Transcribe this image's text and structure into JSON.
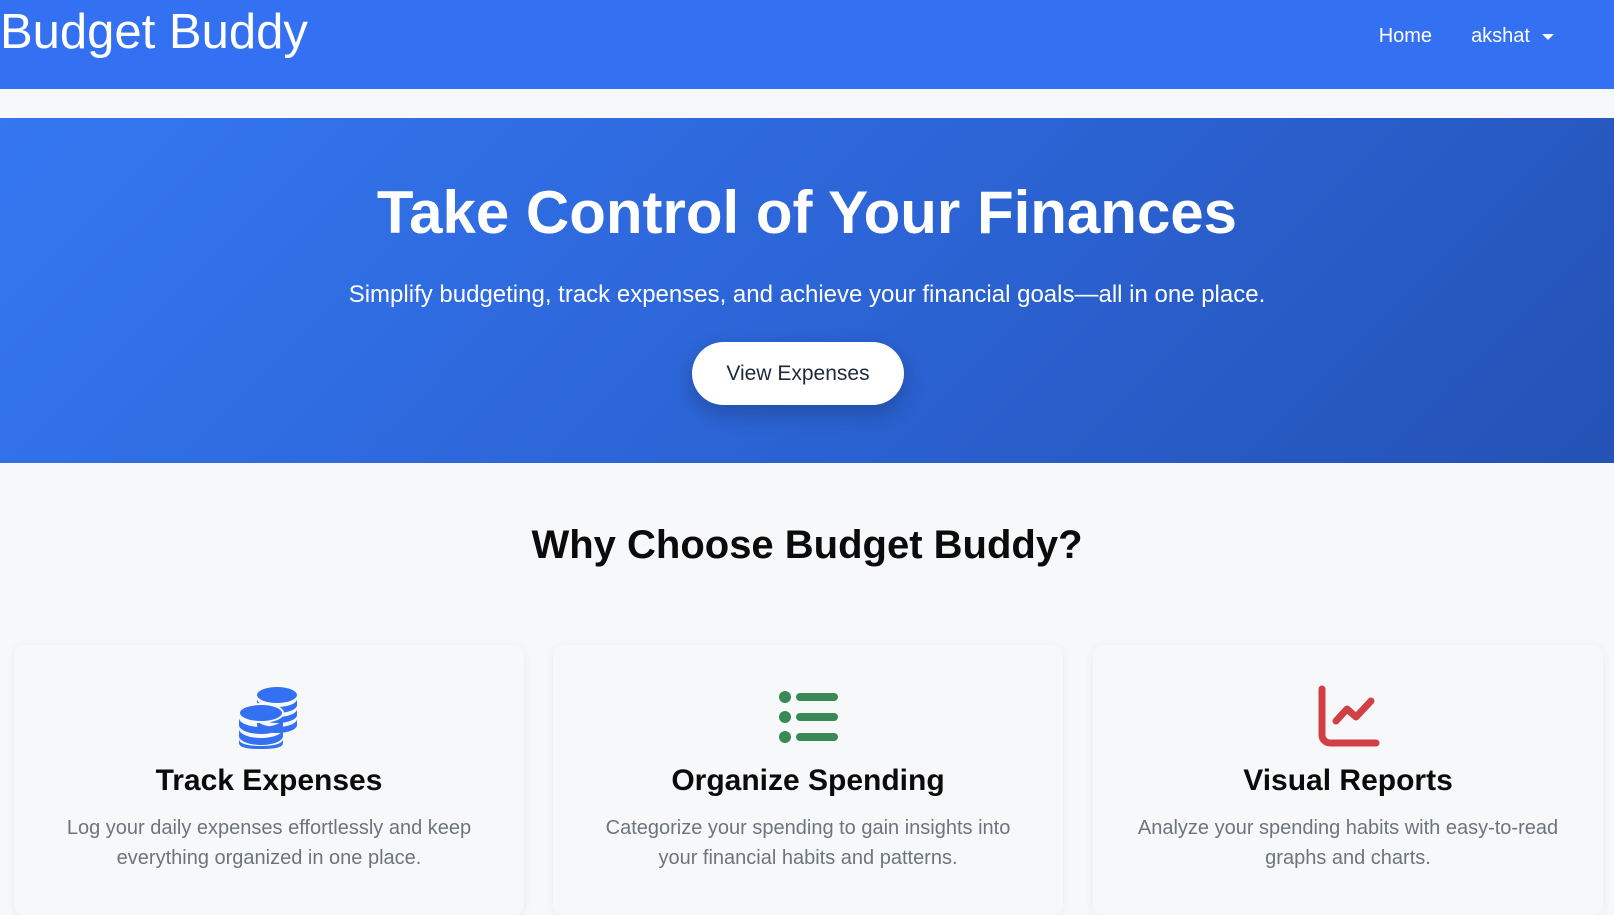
{
  "navbar": {
    "brand": "Budget Buddy",
    "home_label": "Home",
    "user_label": "akshat"
  },
  "hero": {
    "title": "Take Control of Your Finances",
    "subtitle": "Simplify budgeting, track expenses, and achieve your financial goals—all in one place.",
    "button_label": "View Expenses"
  },
  "features": {
    "title": "Why Choose Budget Buddy?",
    "items": [
      {
        "icon": "coins-icon",
        "icon_color": "#3470f2",
        "title": "Track Expenses",
        "text": "Log your daily expenses effortlessly and keep everything organized in one place."
      },
      {
        "icon": "list-icon",
        "icon_color": "#3a8a57",
        "title": "Organize Spending",
        "text": "Categorize your spending to gain insights into your financial habits and patterns."
      },
      {
        "icon": "chart-line-icon",
        "icon_color": "#d13f47",
        "title": "Visual Reports",
        "text": "Analyze your spending habits with easy-to-read graphs and charts."
      }
    ]
  },
  "colors": {
    "navbar": "#3470f2",
    "hero_start": "#3577f1",
    "hero_end": "#2452b5",
    "page_bg": "#f7f8fa"
  }
}
